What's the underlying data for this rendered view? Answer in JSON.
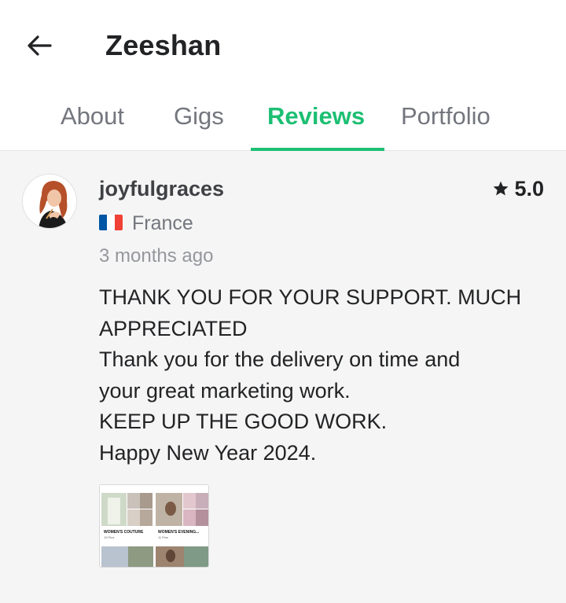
{
  "header": {
    "title": "Zeeshan",
    "back_icon": "back-arrow-icon"
  },
  "tabs": [
    {
      "label": "About",
      "active": false
    },
    {
      "label": "Gigs",
      "active": false
    },
    {
      "label": "Reviews",
      "active": true
    },
    {
      "label": "Portfolio",
      "active": false
    }
  ],
  "review": {
    "username": "joyfulgraces",
    "rating": "5.0",
    "star_icon": "star-icon",
    "country": "France",
    "flag_colors": [
      "#0055a4",
      "#ffffff",
      "#ef4135"
    ],
    "time_ago": "3 months ago",
    "lines": [
      "THANK YOU FOR YOUR SUPPORT.  MUCH",
      "APPRECIATED",
      "Thank you for the delivery on time and",
      "your great marketing work.",
      "KEEP UP THE GOOD WORK.",
      "Happy New Year 2024."
    ],
    "attachment": {
      "caption_left": "WOMEN'S COUTURE",
      "caption_right": "WOMEN'S EVENING...",
      "sub_left": "19 Pins",
      "sub_right": "11 Pins"
    }
  },
  "colors": {
    "accent": "#1dbf73",
    "tab_inactive": "#74767e",
    "background": "#f5f5f5"
  }
}
